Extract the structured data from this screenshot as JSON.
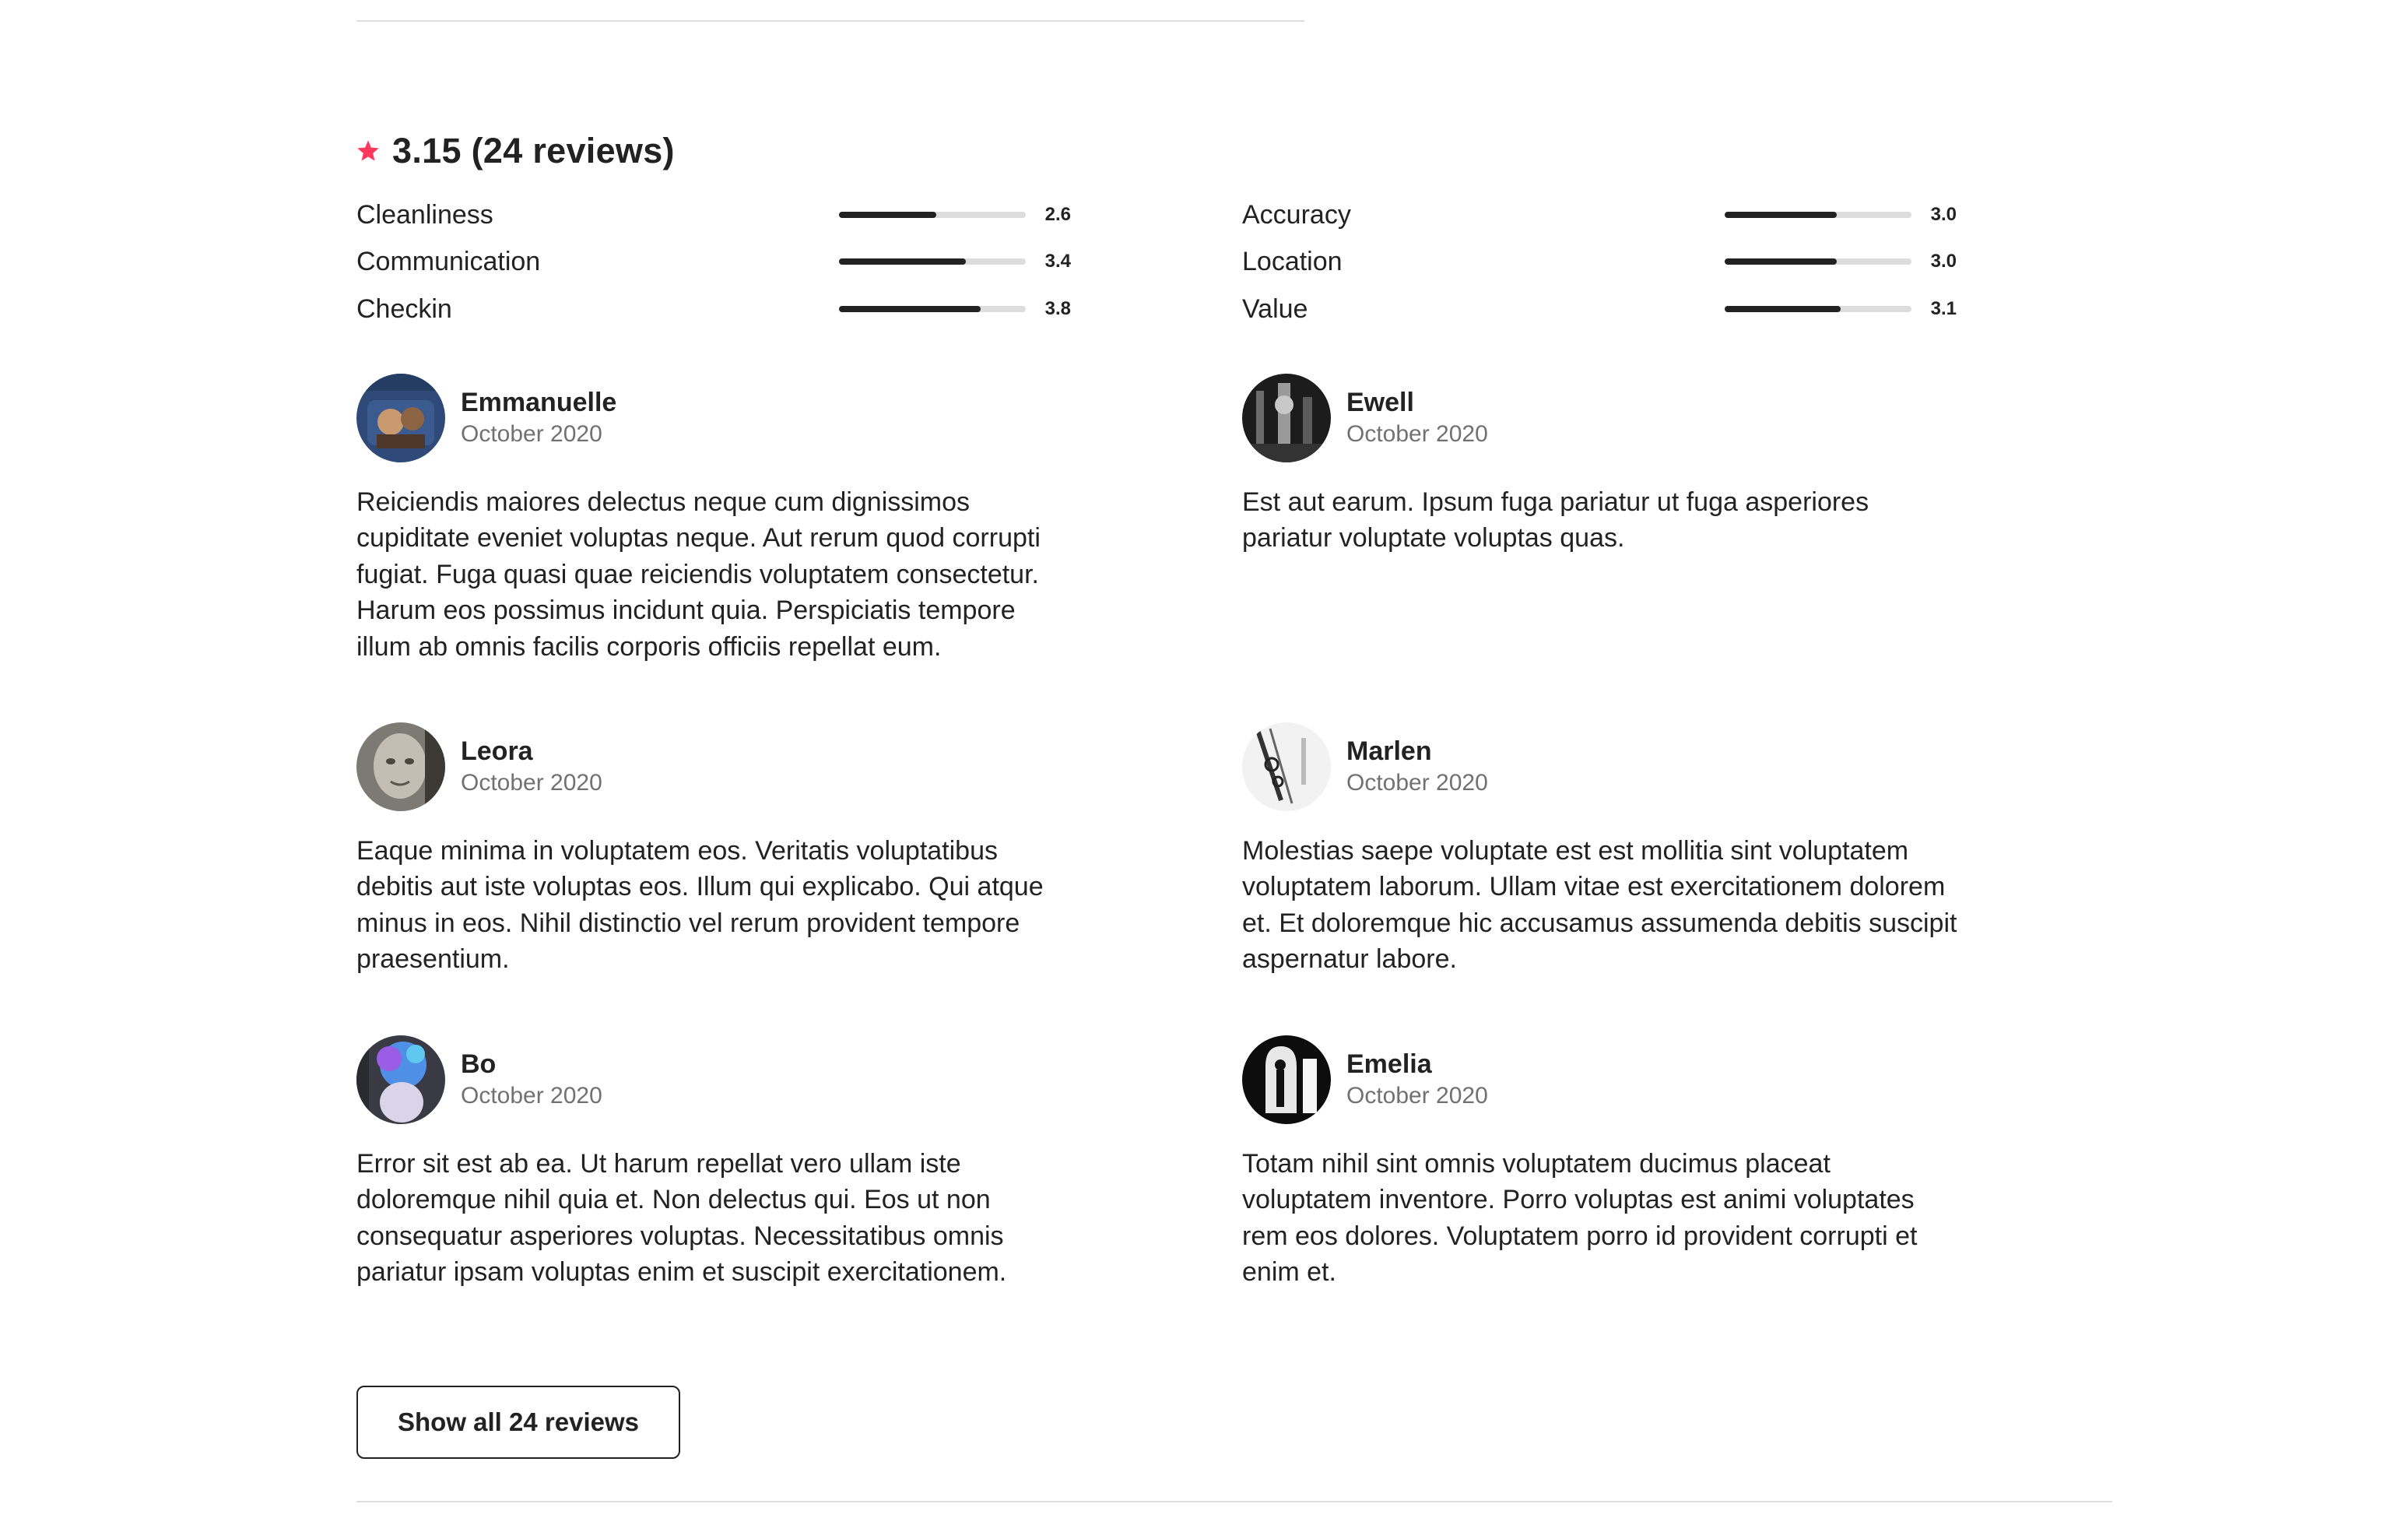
{
  "summary": {
    "text": "3.15 (24 reviews)",
    "star_icon": "star-icon",
    "accent_color": "#FF385C"
  },
  "ratings": {
    "cleanliness": {
      "label": "Cleanliness",
      "value": "2.6",
      "fraction": 0.52
    },
    "communication": {
      "label": "Communication",
      "value": "3.4",
      "fraction": 0.68
    },
    "checkin": {
      "label": "Checkin",
      "value": "3.8",
      "fraction": 0.76
    },
    "accuracy": {
      "label": "Accuracy",
      "value": "3.0",
      "fraction": 0.6
    },
    "location": {
      "label": "Location",
      "value": "3.0",
      "fraction": 0.6
    },
    "value": {
      "label": "Value",
      "value": "3.1",
      "fraction": 0.62
    }
  },
  "reviews": [
    {
      "name": "Emmanuelle",
      "date": "October 2020",
      "text": "Reiciendis maiores delectus neque cum dignissimos cupiditate eveniet voluptas neque. Aut rerum quod corrupti fugiat. Fuga quasi quae reiciendis voluptatem consectetur. Harum eos possimus incidunt quia. Perspiciatis tempore illum ab omnis facilis corporis officiis repellat eum."
    },
    {
      "name": "Ewell",
      "date": "October 2020",
      "text": "Est aut earum. Ipsum fuga pariatur ut fuga asperiores pariatur voluptate voluptas quas."
    },
    {
      "name": "Leora",
      "date": "October 2020",
      "text": "Eaque minima in voluptatem eos. Veritatis voluptatibus debitis aut iste voluptas eos. Illum qui explicabo. Qui atque minus in eos. Nihil distinctio vel rerum provident tempore praesentium."
    },
    {
      "name": "Marlen",
      "date": "October 2020",
      "text": "Molestias saepe voluptate est est mollitia sint voluptatem voluptatem laborum. Ullam vitae est exercitationem dolorem et. Et doloremque hic accusamus assumenda debitis suscipit aspernatur labore."
    },
    {
      "name": "Bo",
      "date": "October 2020",
      "text": "Error sit est ab ea. Ut harum repellat vero ullam iste doloremque nihil quia et. Non delectus qui. Eos ut non consequatur asperiores voluptas. Necessitatibus omnis pariatur ipsam voluptas enim et suscipit exercitationem."
    },
    {
      "name": "Emelia",
      "date": "October 2020",
      "text": "Totam nihil sint omnis voluptatem ducimus placeat voluptatem inventore. Porro voluptas est animi voluptates rem eos dolores. Voluptatem porro id provident corrupti et enim et."
    }
  ],
  "show_all_button": {
    "label": "Show all 24 reviews"
  }
}
